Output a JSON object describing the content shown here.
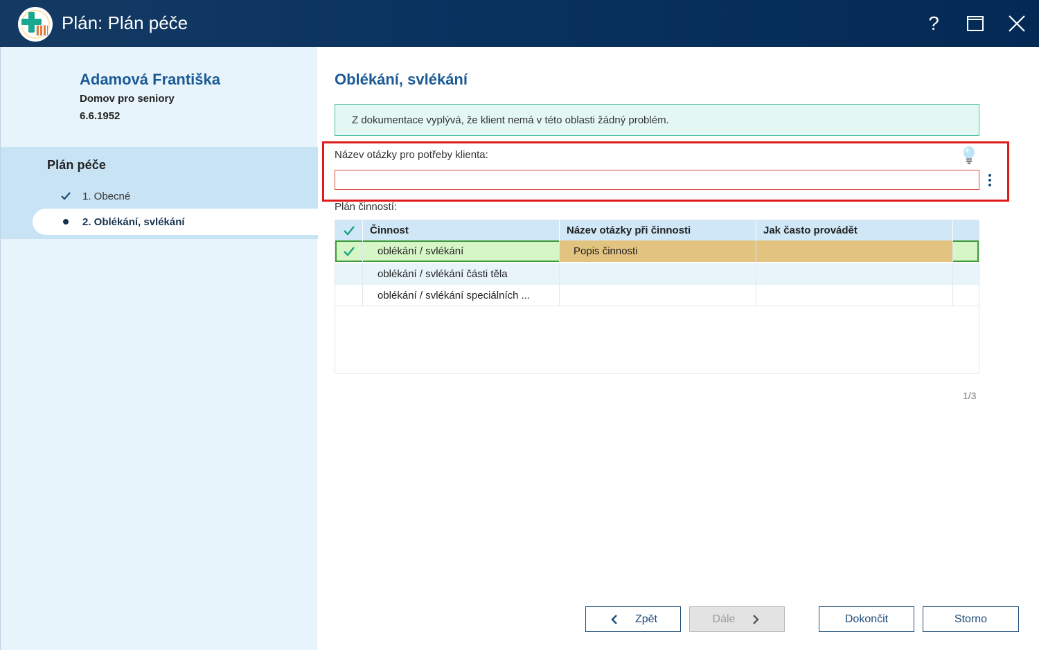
{
  "window": {
    "title": "Plán: Plán péče",
    "help_label": "?",
    "icons": {
      "help": "help-icon",
      "maximize": "maximize-icon",
      "close": "close-icon"
    },
    "titlebar_color": "#0b3360"
  },
  "patient": {
    "name": "Adamová Františka",
    "organization": "Domov pro seniory",
    "birth_date": "6.6.1952"
  },
  "navigation": {
    "header": "Plán péče",
    "steps": [
      {
        "label": "1. Obecné",
        "state": "done",
        "icon": "checkmark-icon"
      },
      {
        "label": "2. Oblékání, svlékání",
        "state": "current",
        "icon": "bullet-icon"
      }
    ]
  },
  "main": {
    "title": "Oblékání, svlékání",
    "info_message": "Z dokumentace vyplývá, že klient nemá v této oblasti žádný problém.",
    "question_label": "Název otázky pro potřeby klienta:",
    "question_value": "",
    "plan_label": "Plán činností:"
  },
  "grid": {
    "columns": [
      "Činnost",
      "Název otázky při činnosti",
      "Jak často provádět"
    ],
    "rows": [
      {
        "checked": true,
        "activity": "oblékání / svlékání",
        "question": "Popis činnosti",
        "frequency": ""
      },
      {
        "checked": false,
        "activity": "oblékání / svlékání části těla",
        "question": "",
        "frequency": ""
      },
      {
        "checked": false,
        "activity": "oblékání / svlékání speciálních ...",
        "question": "",
        "frequency": ""
      }
    ],
    "pager": "1/3"
  },
  "footer": {
    "back_label": "Zpět",
    "next_label": "Dále",
    "finish_label": "Dokončit",
    "cancel_label": "Storno"
  },
  "colors": {
    "accent": "#1b5a95",
    "highlight_frame": "#e01b1b",
    "selected_row": "#d7f6c7",
    "question_cell": "#e2c380",
    "info_border": "#4fc1a6"
  }
}
